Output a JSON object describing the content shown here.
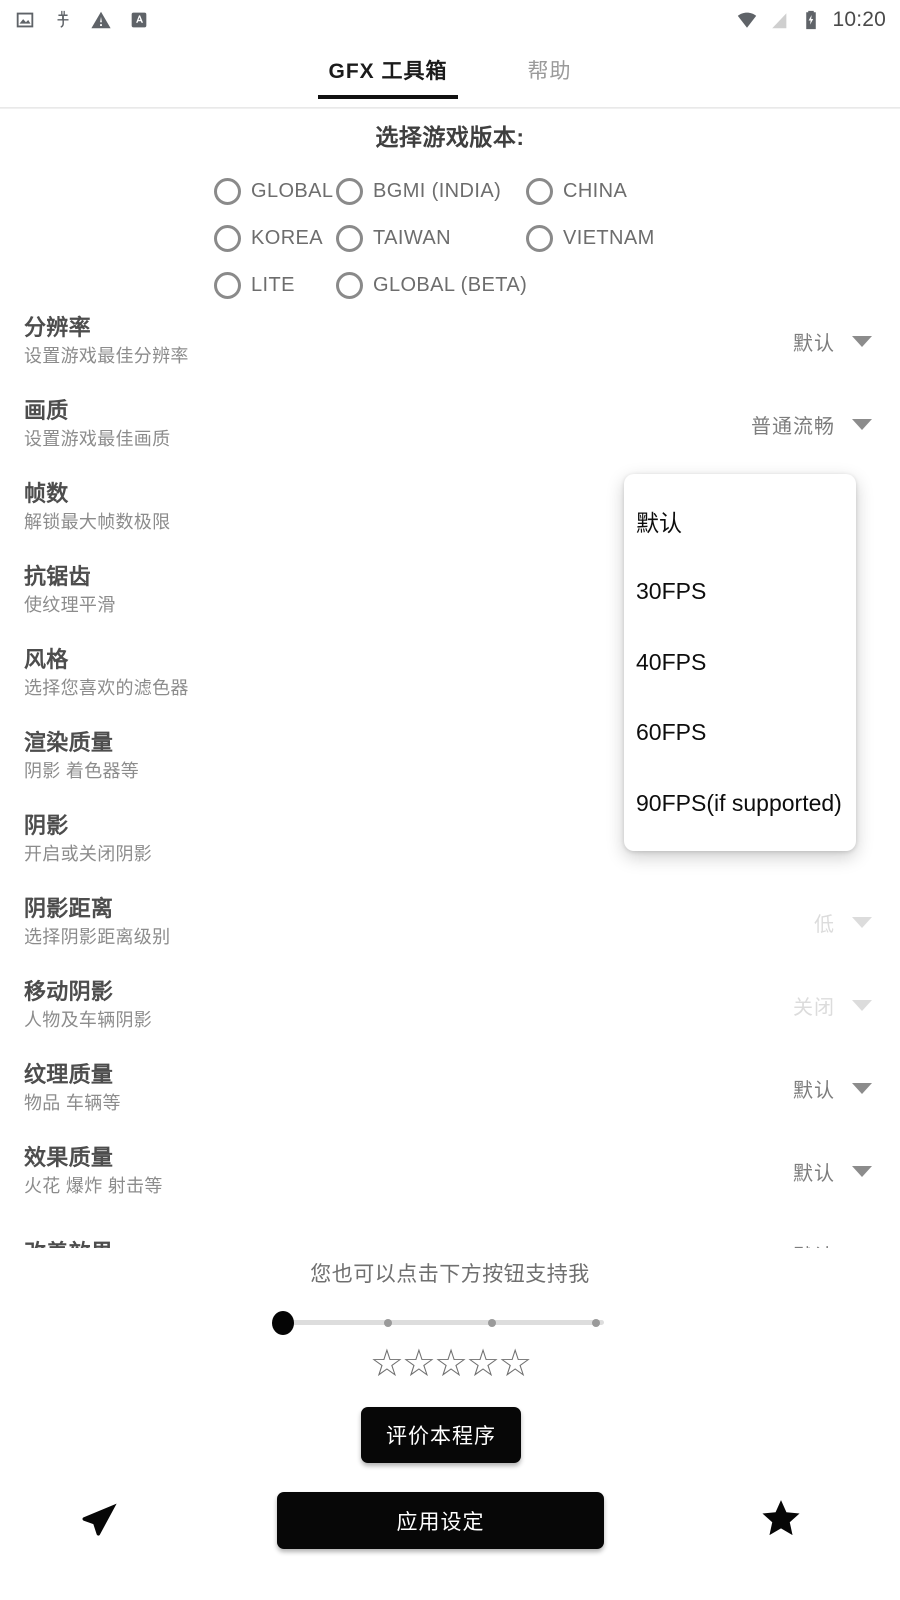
{
  "statusbar": {
    "icons": [
      "image-icon",
      "bug-icon",
      "warning-icon",
      "translate-icon"
    ],
    "right_icons": [
      "wifi-icon",
      "signal-icon",
      "battery-charging-icon"
    ],
    "time": "10:20"
  },
  "tabs": [
    {
      "label": "GFX 工具箱",
      "active": true
    },
    {
      "label": "帮助",
      "active": false
    }
  ],
  "version_selector": {
    "title": "选择游戏版本:",
    "rows": [
      [
        {
          "label": "GLOBAL",
          "selected": false
        },
        {
          "label": "BGMI (INDIA)",
          "selected": false
        },
        {
          "label": "CHINA",
          "selected": false
        }
      ],
      [
        {
          "label": "KOREA",
          "selected": false
        },
        {
          "label": "TAIWAN",
          "selected": false
        },
        {
          "label": "VIETNAM",
          "selected": false
        }
      ],
      [
        {
          "label": "LITE",
          "selected": false
        },
        {
          "label": "GLOBAL (BETA)",
          "selected": false
        }
      ]
    ]
  },
  "settings": [
    {
      "title": "分辨率",
      "subtitle": "设置游戏最佳分辨率",
      "value": "默认",
      "disabled": false
    },
    {
      "title": "画质",
      "subtitle": "设置游戏最佳画质",
      "value": "普通流畅",
      "disabled": false
    },
    {
      "title": "帧数",
      "subtitle": "解锁最大帧数极限",
      "value": "",
      "disabled": false
    },
    {
      "title": "抗锯齿",
      "subtitle": "使纹理平滑",
      "value": "",
      "disabled": false
    },
    {
      "title": "风格",
      "subtitle": "选择您喜欢的滤色器",
      "value": "",
      "disabled": false
    },
    {
      "title": "渲染质量",
      "subtitle": "阴影 着色器等",
      "value": "",
      "disabled": false
    },
    {
      "title": "阴影",
      "subtitle": "开启或关闭阴影",
      "value": "",
      "disabled": false
    },
    {
      "title": "阴影距离",
      "subtitle": "选择阴影距离级别",
      "value": "低",
      "disabled": true
    },
    {
      "title": "移动阴影",
      "subtitle": "人物及车辆阴影",
      "value": "关闭",
      "disabled": true
    },
    {
      "title": "纹理质量",
      "subtitle": "物品 车辆等",
      "value": "默认",
      "disabled": false
    },
    {
      "title": "效果质量",
      "subtitle": "火花 爆炸 射击等",
      "value": "默认",
      "disabled": false
    },
    {
      "title": "改善效果",
      "subtitle": "",
      "value": "默认",
      "disabled": false
    }
  ],
  "dropdown": {
    "open_for": "帧数",
    "items": [
      "默认",
      "30FPS",
      "40FPS",
      "60FPS",
      "90FPS(if supported)"
    ]
  },
  "support": {
    "text": "您也可以点击下方按钮支持我",
    "slider": {
      "position": 0,
      "ticks": 4
    },
    "stars": "☆☆☆☆☆",
    "rate_button": "评价本程序"
  },
  "bottom_bar": {
    "send_icon": "send-icon",
    "apply_button": "应用设定",
    "star_icon": "star-icon"
  }
}
